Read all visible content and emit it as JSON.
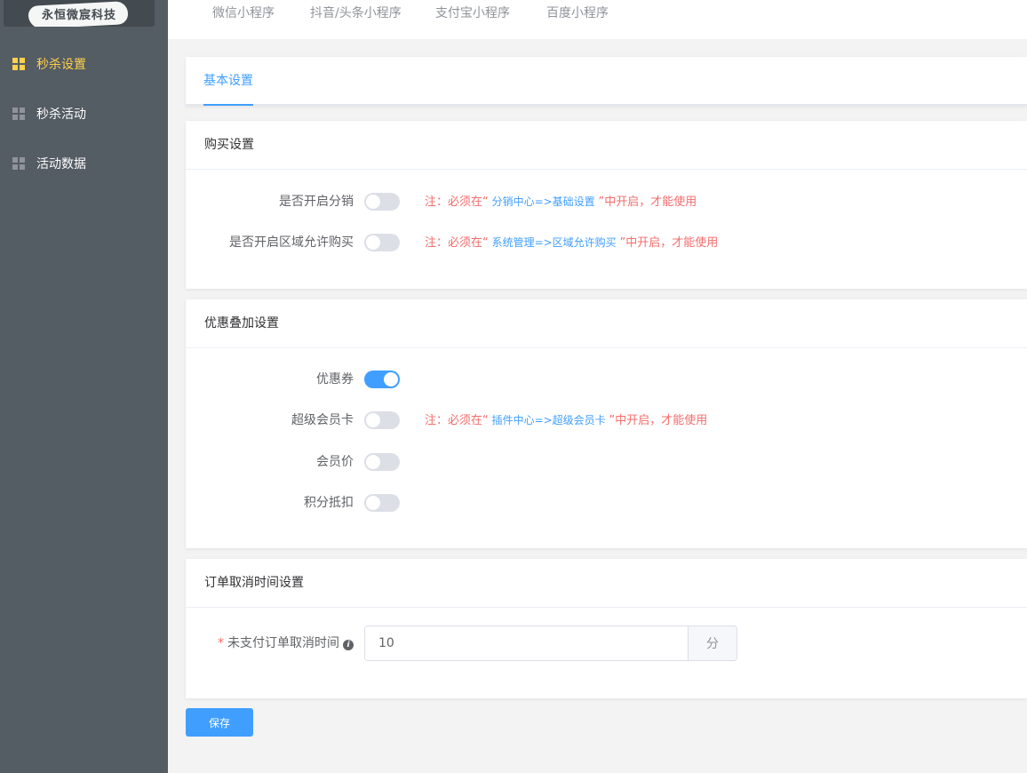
{
  "sidebar": {
    "logo": "永恒微宸科技",
    "items": [
      {
        "label": "秒杀设置",
        "active": true
      },
      {
        "label": "秒杀活动",
        "active": false
      },
      {
        "label": "活动数据",
        "active": false
      }
    ]
  },
  "top_tabs": [
    "微信小程序",
    "抖音/头条小程序",
    "支付宝小程序",
    "百度小程序"
  ],
  "inner_tabs": [
    "基本设置"
  ],
  "purchase": {
    "title": "购买设置",
    "distribution": {
      "label": "是否开启分销",
      "on": false,
      "note_prefix": "注：必须在“",
      "note_link": " 分销中心=>基础设置 ",
      "note_suffix": "”中开启，才能使用"
    },
    "region": {
      "label": "是否开启区域允许购买",
      "on": false,
      "note_prefix": "注：必须在“",
      "note_link": " 系统管理=>区域允许购买 ",
      "note_suffix": "”中开启，才能使用"
    }
  },
  "discount": {
    "title": "优惠叠加设置",
    "coupon": {
      "label": "优惠券",
      "on": true
    },
    "vip_card": {
      "label": "超级会员卡",
      "on": false,
      "note_prefix": "注：必须在“",
      "note_link": " 插件中心=>超级会员卡 ",
      "note_suffix": "”中开启，才能使用"
    },
    "member_price": {
      "label": "会员价",
      "on": false
    },
    "points": {
      "label": "积分抵扣",
      "on": false
    }
  },
  "cancel": {
    "title": "订单取消时间设置",
    "field_label": "未支付订单取消时间",
    "value": "10",
    "unit": "分"
  },
  "save_label": "保存",
  "colors": {
    "primary": "#409eff",
    "danger": "#f56c6c",
    "sidebar": "#545c64",
    "active_menu": "#ffd04b"
  }
}
